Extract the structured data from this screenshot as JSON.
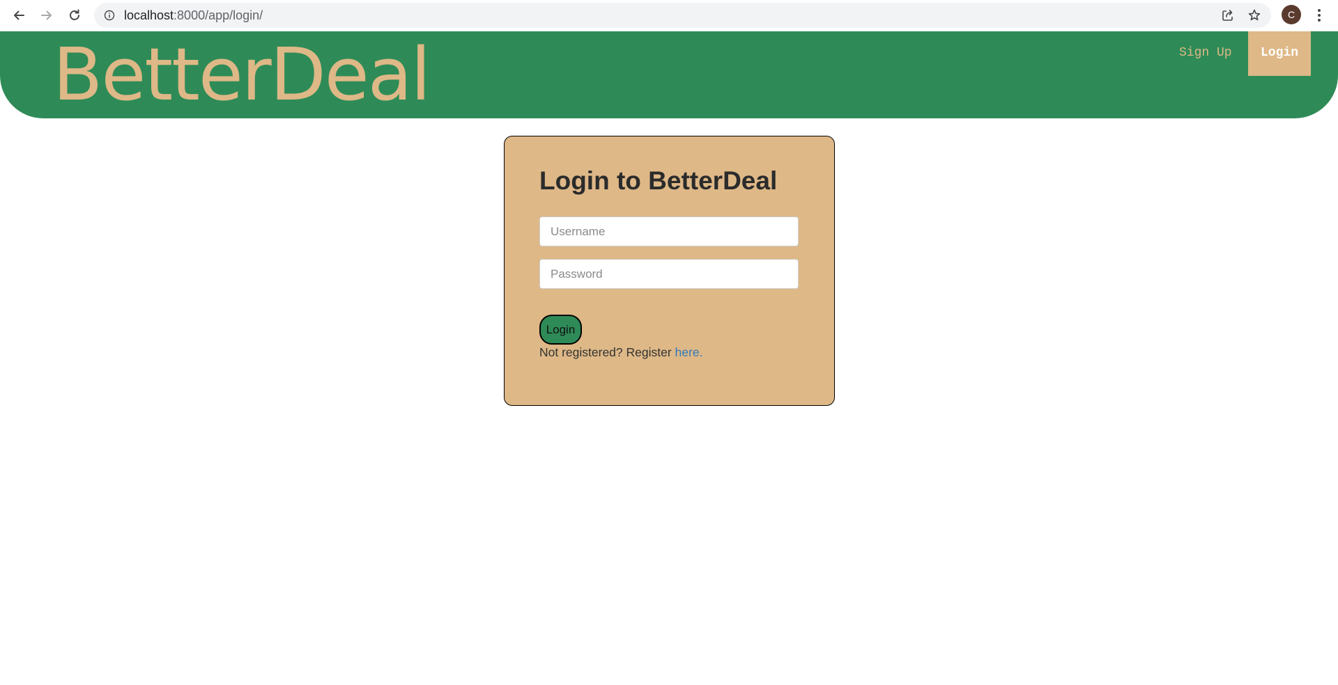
{
  "browser": {
    "url_host": "localhost",
    "url_rest": ":8000/app/login/",
    "avatar_initial": "C"
  },
  "header": {
    "brand": "BetterDeal",
    "nav": {
      "signup_label": "Sign Up",
      "login_label": "Login"
    }
  },
  "login_card": {
    "title": "Login to BetterDeal",
    "username_placeholder": "Username",
    "password_placeholder": "Password",
    "submit_label": "Login",
    "register_prompt": "Not registered? Register ",
    "register_link": "here."
  },
  "colors": {
    "header_bg": "#2e8b57",
    "accent_tan": "#deb887",
    "link_blue": "#337ab7"
  },
  "icons": {
    "back": "arrow-left-icon",
    "forward": "arrow-right-icon",
    "reload": "reload-icon",
    "site_info": "info-icon",
    "share": "share-icon",
    "bookmark": "star-icon",
    "menu": "kebab-menu-icon"
  }
}
